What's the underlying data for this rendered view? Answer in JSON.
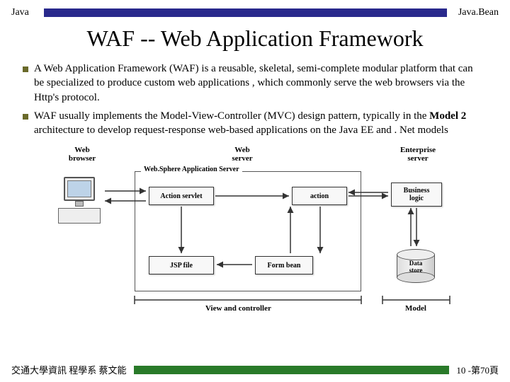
{
  "header": {
    "left": "Java",
    "right": "Java.Bean"
  },
  "title": "WAF -- Web Application Framework",
  "bullets": [
    {
      "pre": "A Web Application Framework (WAF) is a reusable, skeletal, semi-complete modular platform that can be specialized to produce custom web applications , which commonly serve the web browsers via the Http's protocol.",
      "bold": "",
      "post": ""
    },
    {
      "pre": "WAF usually implements the Model-View-Controller (MVC) design pattern, typically in the ",
      "bold": "Model 2",
      "post": " architecture to develop request-response web-based applications on the Java EE and . Net models"
    }
  ],
  "diagram": {
    "cols": {
      "browser": "Web\nbrowser",
      "server": "Web\nserver",
      "enterprise": "Enterprise\nserver"
    },
    "group": "Web.Sphere Application Server",
    "nodes": {
      "servlet": "Action servlet",
      "jsp": "JSP file",
      "action": "action",
      "formbean": "Form bean",
      "biz": "Business\nlogic",
      "store": "Data\nstore"
    },
    "bottom": {
      "vc": "View and controller",
      "model": "Model"
    }
  },
  "footer": {
    "left": "交通大學資訊 程學系 蔡文能",
    "right": "10 -第70頁"
  }
}
